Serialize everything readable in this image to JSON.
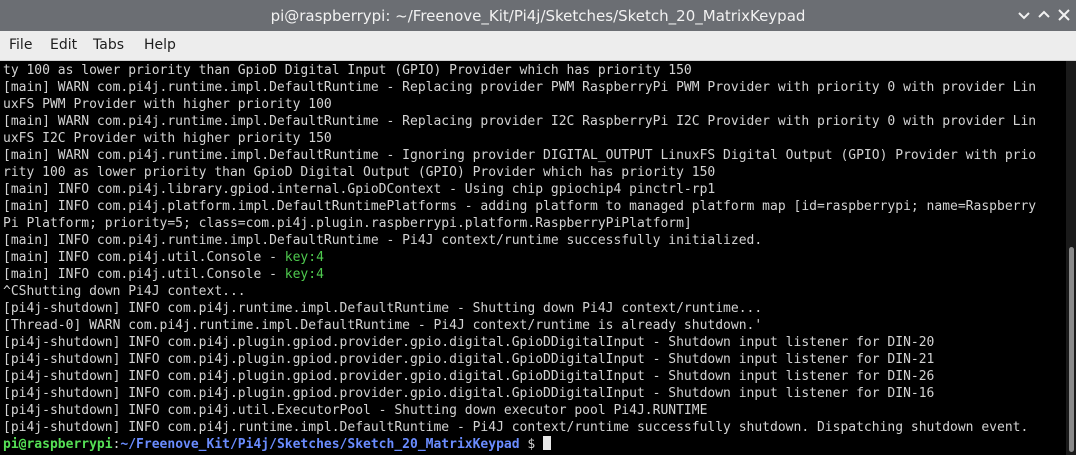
{
  "window": {
    "title": "pi@raspberrypi: ~/Freenove_Kit/Pi4j/Sketches/Sketch_20_MatrixKeypad"
  },
  "menu": {
    "items": [
      "File",
      "Edit",
      "Tabs",
      "Help"
    ]
  },
  "terminal": {
    "lines": [
      {
        "a": "ty 100 as lower priority than GpioD Digital Input (GPIO) Provider which has priority 150"
      },
      {
        "a": "[main] WARN com.pi4j.runtime.impl.DefaultRuntime - Replacing provider PWM RaspberryPi PWM Provider with priority 0 with provider Lin"
      },
      {
        "a": "uxFS PWM Provider with higher priority 100"
      },
      {
        "a": "[main] WARN com.pi4j.runtime.impl.DefaultRuntime - Replacing provider I2C RaspberryPi I2C Provider with priority 0 with provider Lin"
      },
      {
        "a": "uxFS I2C Provider with higher priority 150"
      },
      {
        "a": "[main] WARN com.pi4j.runtime.impl.DefaultRuntime - Ignoring provider DIGITAL_OUTPUT LinuxFS Digital Output (GPIO) Provider with prio"
      },
      {
        "a": "rity 100 as lower priority than GpioD Digital Output (GPIO) Provider which has priority 150"
      },
      {
        "a": "[main] INFO com.pi4j.library.gpiod.internal.GpioDContext - Using chip gpiochip4 pinctrl-rp1"
      },
      {
        "a": "[main] INFO com.pi4j.platform.impl.DefaultRuntimePlatforms - adding platform to managed platform map [id=raspberrypi; name=Raspberry"
      },
      {
        "a": "Pi Platform; priority=5; class=com.pi4j.plugin.raspberrypi.platform.RaspberryPiPlatform]"
      },
      {
        "a": "[main] INFO com.pi4j.runtime.impl.DefaultRuntime - Pi4J context/runtime successfully initialized."
      },
      {
        "a": "[main] INFO com.pi4j.util.Console - ",
        "b": "key:4"
      },
      {
        "a": "[main] INFO com.pi4j.util.Console - ",
        "b": "key:4"
      },
      {
        "a": "^CShutting down Pi4J context..."
      },
      {
        "a": "[pi4j-shutdown] INFO com.pi4j.runtime.impl.DefaultRuntime - Shutting down Pi4J context/runtime..."
      },
      {
        "a": "[Thread-0] WARN com.pi4j.runtime.impl.DefaultRuntime - Pi4J context/runtime is already shutdown.'"
      },
      {
        "a": "[pi4j-shutdown] INFO com.pi4j.plugin.gpiod.provider.gpio.digital.GpioDDigitalInput - Shutdown input listener for DIN-20"
      },
      {
        "a": "[pi4j-shutdown] INFO com.pi4j.plugin.gpiod.provider.gpio.digital.GpioDDigitalInput - Shutdown input listener for DIN-21"
      },
      {
        "a": "[pi4j-shutdown] INFO com.pi4j.plugin.gpiod.provider.gpio.digital.GpioDDigitalInput - Shutdown input listener for DIN-26"
      },
      {
        "a": "[pi4j-shutdown] INFO com.pi4j.plugin.gpiod.provider.gpio.digital.GpioDDigitalInput - Shutdown input listener for DIN-16"
      },
      {
        "a": "[pi4j-shutdown] INFO com.pi4j.util.ExecutorPool - Shutting down executor pool Pi4J.RUNTIME"
      },
      {
        "a": "[pi4j-shutdown] INFO com.pi4j.runtime.impl.DefaultRuntime - Pi4J context/runtime successfully shutdown. Dispatching shutdown event."
      }
    ],
    "prompt": {
      "user": "pi@raspberrypi",
      "sep": ":",
      "path": "~/Freenove_Kit/Pi4j/Sketches/Sketch_20_MatrixKeypad",
      "symbol": " $ "
    }
  },
  "colors": {
    "titlebar": "#6b6e73",
    "menubar": "#ededed",
    "terminal_bg": "#000000",
    "terminal_fg": "#d3d3d3",
    "highlight_green": "#4ec94e",
    "prompt_user": "#55e055",
    "prompt_path": "#6a8cff"
  }
}
